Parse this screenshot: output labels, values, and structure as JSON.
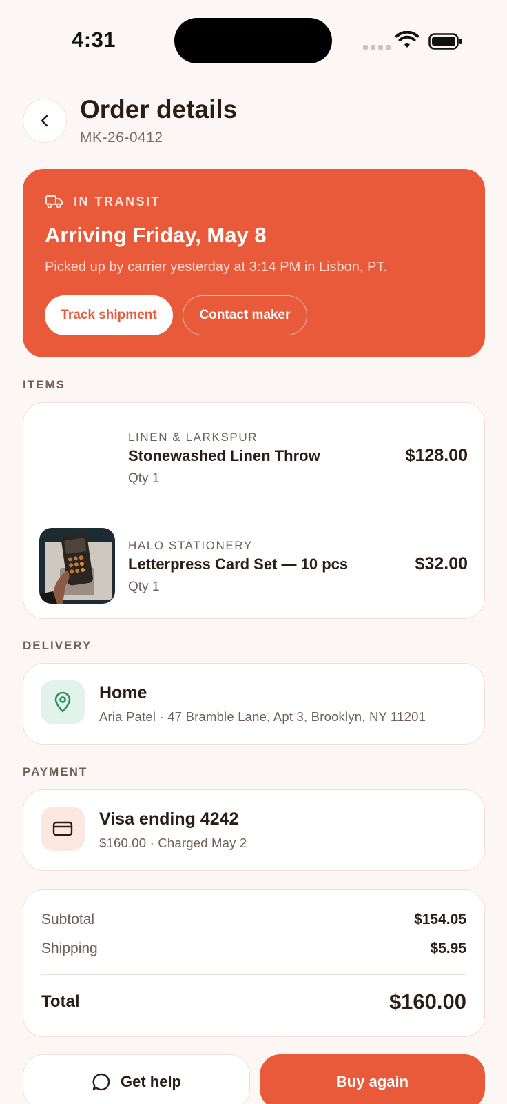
{
  "status_bar": {
    "time": "4:31"
  },
  "header": {
    "title": "Order details",
    "order_id": "MK-26-0412"
  },
  "transit": {
    "status": "IN TRANSIT",
    "title": "Arriving Friday, May 8",
    "subtitle": "Picked up by carrier yesterday at 3:14 PM in Lisbon, PT.",
    "track_label": "Track shipment",
    "contact_label": "Contact maker"
  },
  "items_section": {
    "label": "ITEMS",
    "items": [
      {
        "maker": "LINEN & LARKSPUR",
        "name": "Stonewashed Linen Throw",
        "qty": "Qty 1",
        "price": "$128.00"
      },
      {
        "maker": "HALO STATIONERY",
        "name": "Letterpress Card Set — 10 pcs",
        "qty": "Qty 1",
        "price": "$32.00"
      }
    ]
  },
  "delivery": {
    "label": "DELIVERY",
    "title": "Home",
    "address": "Aria Patel · 47 Bramble Lane, Apt 3, Brooklyn, NY 11201",
    "icon": "map-pin-icon"
  },
  "payment": {
    "label": "PAYMENT",
    "title": "Visa ending 4242",
    "detail": "$160.00 · Charged May 2",
    "icon": "credit-card-icon"
  },
  "totals": {
    "subtotal_label": "Subtotal",
    "subtotal": "$154.05",
    "shipping_label": "Shipping",
    "shipping": "$5.95",
    "total_label": "Total",
    "total": "$160.00"
  },
  "actions": {
    "help_label": "Get help",
    "buy_again_label": "Buy again"
  },
  "colors": {
    "accent": "#e85a3a",
    "background": "#fcf7f4",
    "delivery_icon_bg": "#e2f3ec",
    "payment_icon_bg": "#fbe9e1"
  }
}
